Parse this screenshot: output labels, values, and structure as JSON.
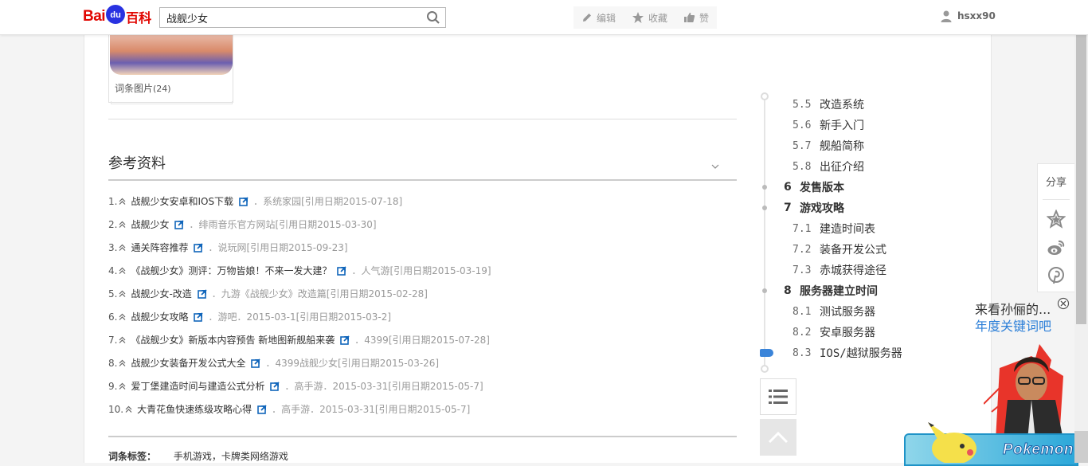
{
  "header": {
    "logo": {
      "bai": "Bai",
      "du": "du",
      "baike": "百科"
    },
    "search_value": "战舰少女",
    "actions": [
      "编辑",
      "收藏",
      "赞"
    ],
    "username": "hsxx90"
  },
  "album": {
    "caption": "词条图片",
    "count": "(24)"
  },
  "references": {
    "title": "参考资料",
    "items": [
      {
        "num": "1.",
        "title": "战舰少女安卓和IOS下载",
        "source": "．系统家园[引用日期2015-07-18]"
      },
      {
        "num": "2.",
        "title": "战舰少女",
        "source": "．绯雨音乐官方网站[引用日期2015-03-30]"
      },
      {
        "num": "3.",
        "title": "通关阵容推荐",
        "source": "．说玩网[引用日期2015-09-23]"
      },
      {
        "num": "4.",
        "title": "《战舰少女》测评：万物皆娘！不来一发大建？",
        "source": "．人气游[引用日期2015-03-19]"
      },
      {
        "num": "5.",
        "title": "战舰少女-改造",
        "source": "．九游《战舰少女》改造篇[引用日期2015-02-28]"
      },
      {
        "num": "6.",
        "title": "战舰少女攻略",
        "source": "．游吧．2015-03-1[引用日期2015-03-2]"
      },
      {
        "num": "7.",
        "title": "《战舰少女》新版本内容预告 新地图新舰船来袭",
        "source": "．4399[引用日期2015-07-28]"
      },
      {
        "num": "8.",
        "title": "战舰少女装备开发公式大全",
        "source": "．4399战舰少女[引用日期2015-03-26]"
      },
      {
        "num": "9.",
        "title": "爱丁堡建造时间与建造公式分析",
        "source": "．高手游．2015-03-31[引用日期2015-05-7]"
      },
      {
        "num": "10.",
        "title": "大青花鱼快速练级攻略心得",
        "source": "．高手游．2015-03-31[引用日期2015-05-7]"
      }
    ]
  },
  "tags": {
    "label": "词条标签：",
    "value": "手机游戏，卡牌类网络游戏"
  },
  "catalog": [
    {
      "num": "5.5",
      "title": "改造系统",
      "level": "sub"
    },
    {
      "num": "5.6",
      "title": "新手入门",
      "level": "sub"
    },
    {
      "num": "5.7",
      "title": "舰船简称",
      "level": "sub"
    },
    {
      "num": "5.8",
      "title": "出征介绍",
      "level": "sub"
    },
    {
      "num": "6",
      "title": "发售版本",
      "level": "top"
    },
    {
      "num": "7",
      "title": "游戏攻略",
      "level": "top"
    },
    {
      "num": "7.1",
      "title": "建造时间表",
      "level": "sub"
    },
    {
      "num": "7.2",
      "title": "装备开发公式",
      "level": "sub"
    },
    {
      "num": "7.3",
      "title": "赤城获得途径",
      "level": "sub"
    },
    {
      "num": "8",
      "title": "服务器建立时间",
      "level": "top"
    },
    {
      "num": "8.1",
      "title": "测试服务器",
      "level": "sub"
    },
    {
      "num": "8.2",
      "title": "安卓服务器",
      "level": "sub"
    },
    {
      "num": "8.3",
      "title": "IOS/越狱服务器",
      "level": "sub"
    }
  ],
  "share": {
    "label": "分享",
    "icons": [
      "star-icon",
      "weibo-icon",
      "pinterest-icon"
    ]
  },
  "ad": {
    "line1": "来看孙俪的...",
    "line2": "年度关键词吧",
    "brand": "Pokemon"
  },
  "colors": {
    "brand_red": "#e10601",
    "brand_blue": "#2932e1",
    "link_blue": "#136ec2",
    "ad_blue": "#2c7fd8",
    "catalog_flag": "#3a84d9"
  }
}
